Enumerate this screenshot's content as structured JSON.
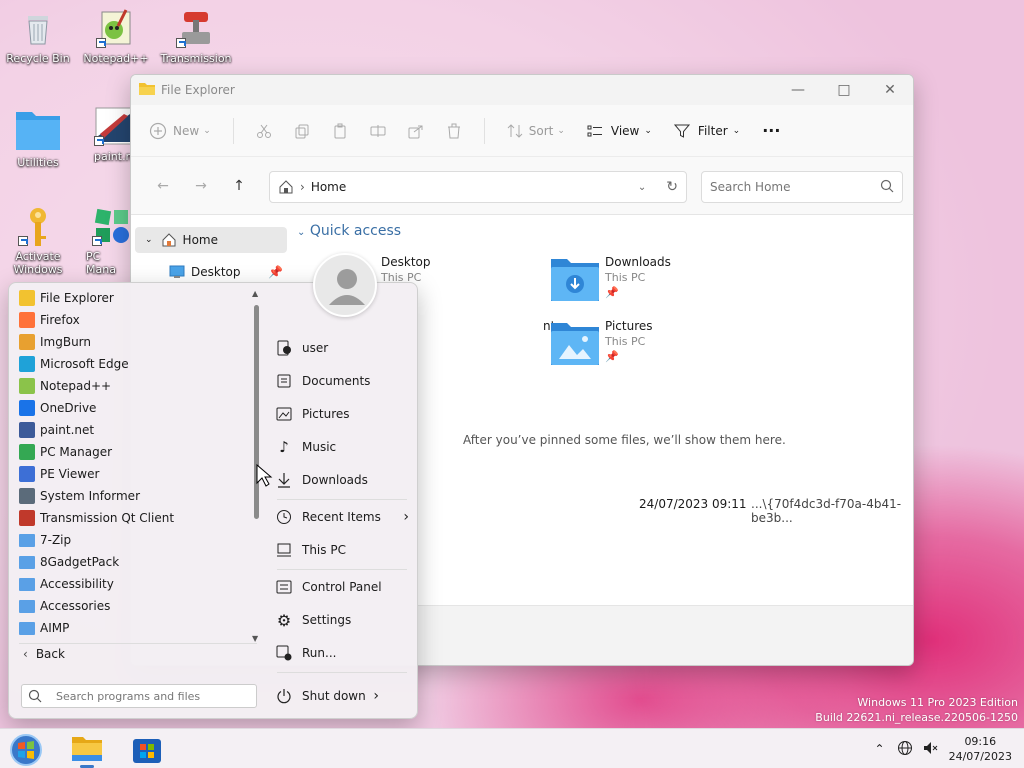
{
  "desktop": {
    "icons": [
      {
        "label": "Recycle Bin",
        "icon": "recycle-bin-icon"
      },
      {
        "label": "Notepad++",
        "icon": "notepadpp-icon"
      },
      {
        "label": "Transmission",
        "icon": "transmission-icon"
      },
      {
        "label": "Utilities",
        "icon": "folder-icon"
      },
      {
        "label": "paint.net",
        "icon": "paintnet-icon"
      },
      {
        "label": "Activate Windows",
        "icon": "key-icon"
      },
      {
        "label": "PC Mana",
        "icon": "pc-manager-icon"
      }
    ]
  },
  "explorer": {
    "title": "File Explorer",
    "toolbar": {
      "new_label": "New",
      "sort_label": "Sort",
      "view_label": "View",
      "filter_label": "Filter",
      "more_label": "···"
    },
    "address": {
      "path": "Home"
    },
    "search": {
      "placeholder": "Search Home"
    },
    "nav": {
      "items": [
        {
          "label": "Home"
        },
        {
          "label": "Desktop"
        }
      ]
    },
    "quick_access": {
      "title": "Quick access",
      "folders": [
        {
          "name": "Desktop",
          "location": "This PC"
        },
        {
          "name": "Downloads",
          "location": "This PC"
        },
        {
          "name": "nts",
          "location": ""
        },
        {
          "name": "Pictures",
          "location": "This PC"
        }
      ]
    },
    "recent": {
      "empty_message": "After you’ve pinned some files, we’ll show them here.",
      "row_date": "24/07/2023 09:11",
      "row_path": "...\\{70f4dc3d-f70a-4b41-be3b..."
    }
  },
  "start_menu": {
    "programs": [
      {
        "label": "File Explorer",
        "color": "#f2c230"
      },
      {
        "label": "Firefox",
        "color": "#ff7139"
      },
      {
        "label": "ImgBurn",
        "color": "#e8a030"
      },
      {
        "label": "Microsoft Edge",
        "color": "#1fa2d8"
      },
      {
        "label": "Notepad++",
        "color": "#8bc34a"
      },
      {
        "label": "OneDrive",
        "color": "#1a73e8"
      },
      {
        "label": "paint.net",
        "color": "#3c5a99"
      },
      {
        "label": "PC Manager",
        "color": "#34a853"
      },
      {
        "label": "PE Viewer",
        "color": "#3d6fd6"
      },
      {
        "label": "System Informer",
        "color": "#5b6b7a"
      },
      {
        "label": "Transmission Qt Client",
        "color": "#c0392b"
      },
      {
        "label": "7-Zip",
        "color": "#5aa0e6"
      },
      {
        "label": "8GadgetPack",
        "color": "#5aa0e6"
      },
      {
        "label": "Accessibility",
        "color": "#5aa0e6"
      },
      {
        "label": "Accessories",
        "color": "#5aa0e6"
      },
      {
        "label": "AIMP",
        "color": "#5aa0e6"
      }
    ],
    "back_label": "Back",
    "search_placeholder": "Search programs and files",
    "right": {
      "user": "user",
      "documents": "Documents",
      "pictures": "Pictures",
      "music": "Music",
      "downloads": "Downloads",
      "recent_items": "Recent Items",
      "this_pc": "This PC",
      "control_panel": "Control Panel",
      "settings": "Settings",
      "run": "Run...",
      "shutdown": "Shut down"
    }
  },
  "watermark": {
    "line1": "Windows 11 Pro 2023 Edition",
    "line2": "Build 22621.ni_release.220506-1250"
  },
  "taskbar": {
    "time": "09:16",
    "date": "24/07/2023"
  }
}
